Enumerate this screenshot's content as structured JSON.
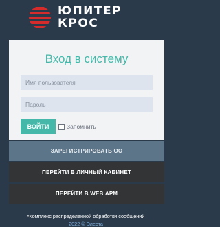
{
  "brand": {
    "line1": "ЮПИТЕР",
    "line2": "КРОС",
    "logo_icon": "jupiter-planet-icon",
    "logo_color": "#d62b2b"
  },
  "login": {
    "title": "Вход в систему",
    "username_placeholder": "Имя пользователя",
    "username_value": "",
    "password_placeholder": "Пароль",
    "password_value": "",
    "submit_label": "ВОЙТИ",
    "remember_label": "Запомнить",
    "remember_checked": false,
    "accent_color": "#45b8a9"
  },
  "actions": {
    "register_label": "ЗАРЕГИСТРИРОВАТЬ ОО",
    "cabinet_label": "ПЕРЕЙТИ В ЛИЧНЫЙ КАБИНЕТ",
    "webarm_label": "ПЕРЕЙТИ В WEB АРМ"
  },
  "footer": {
    "note": "*Комплекс распределенной обработки сообщений",
    "copyright": "2022 © Элеста"
  }
}
